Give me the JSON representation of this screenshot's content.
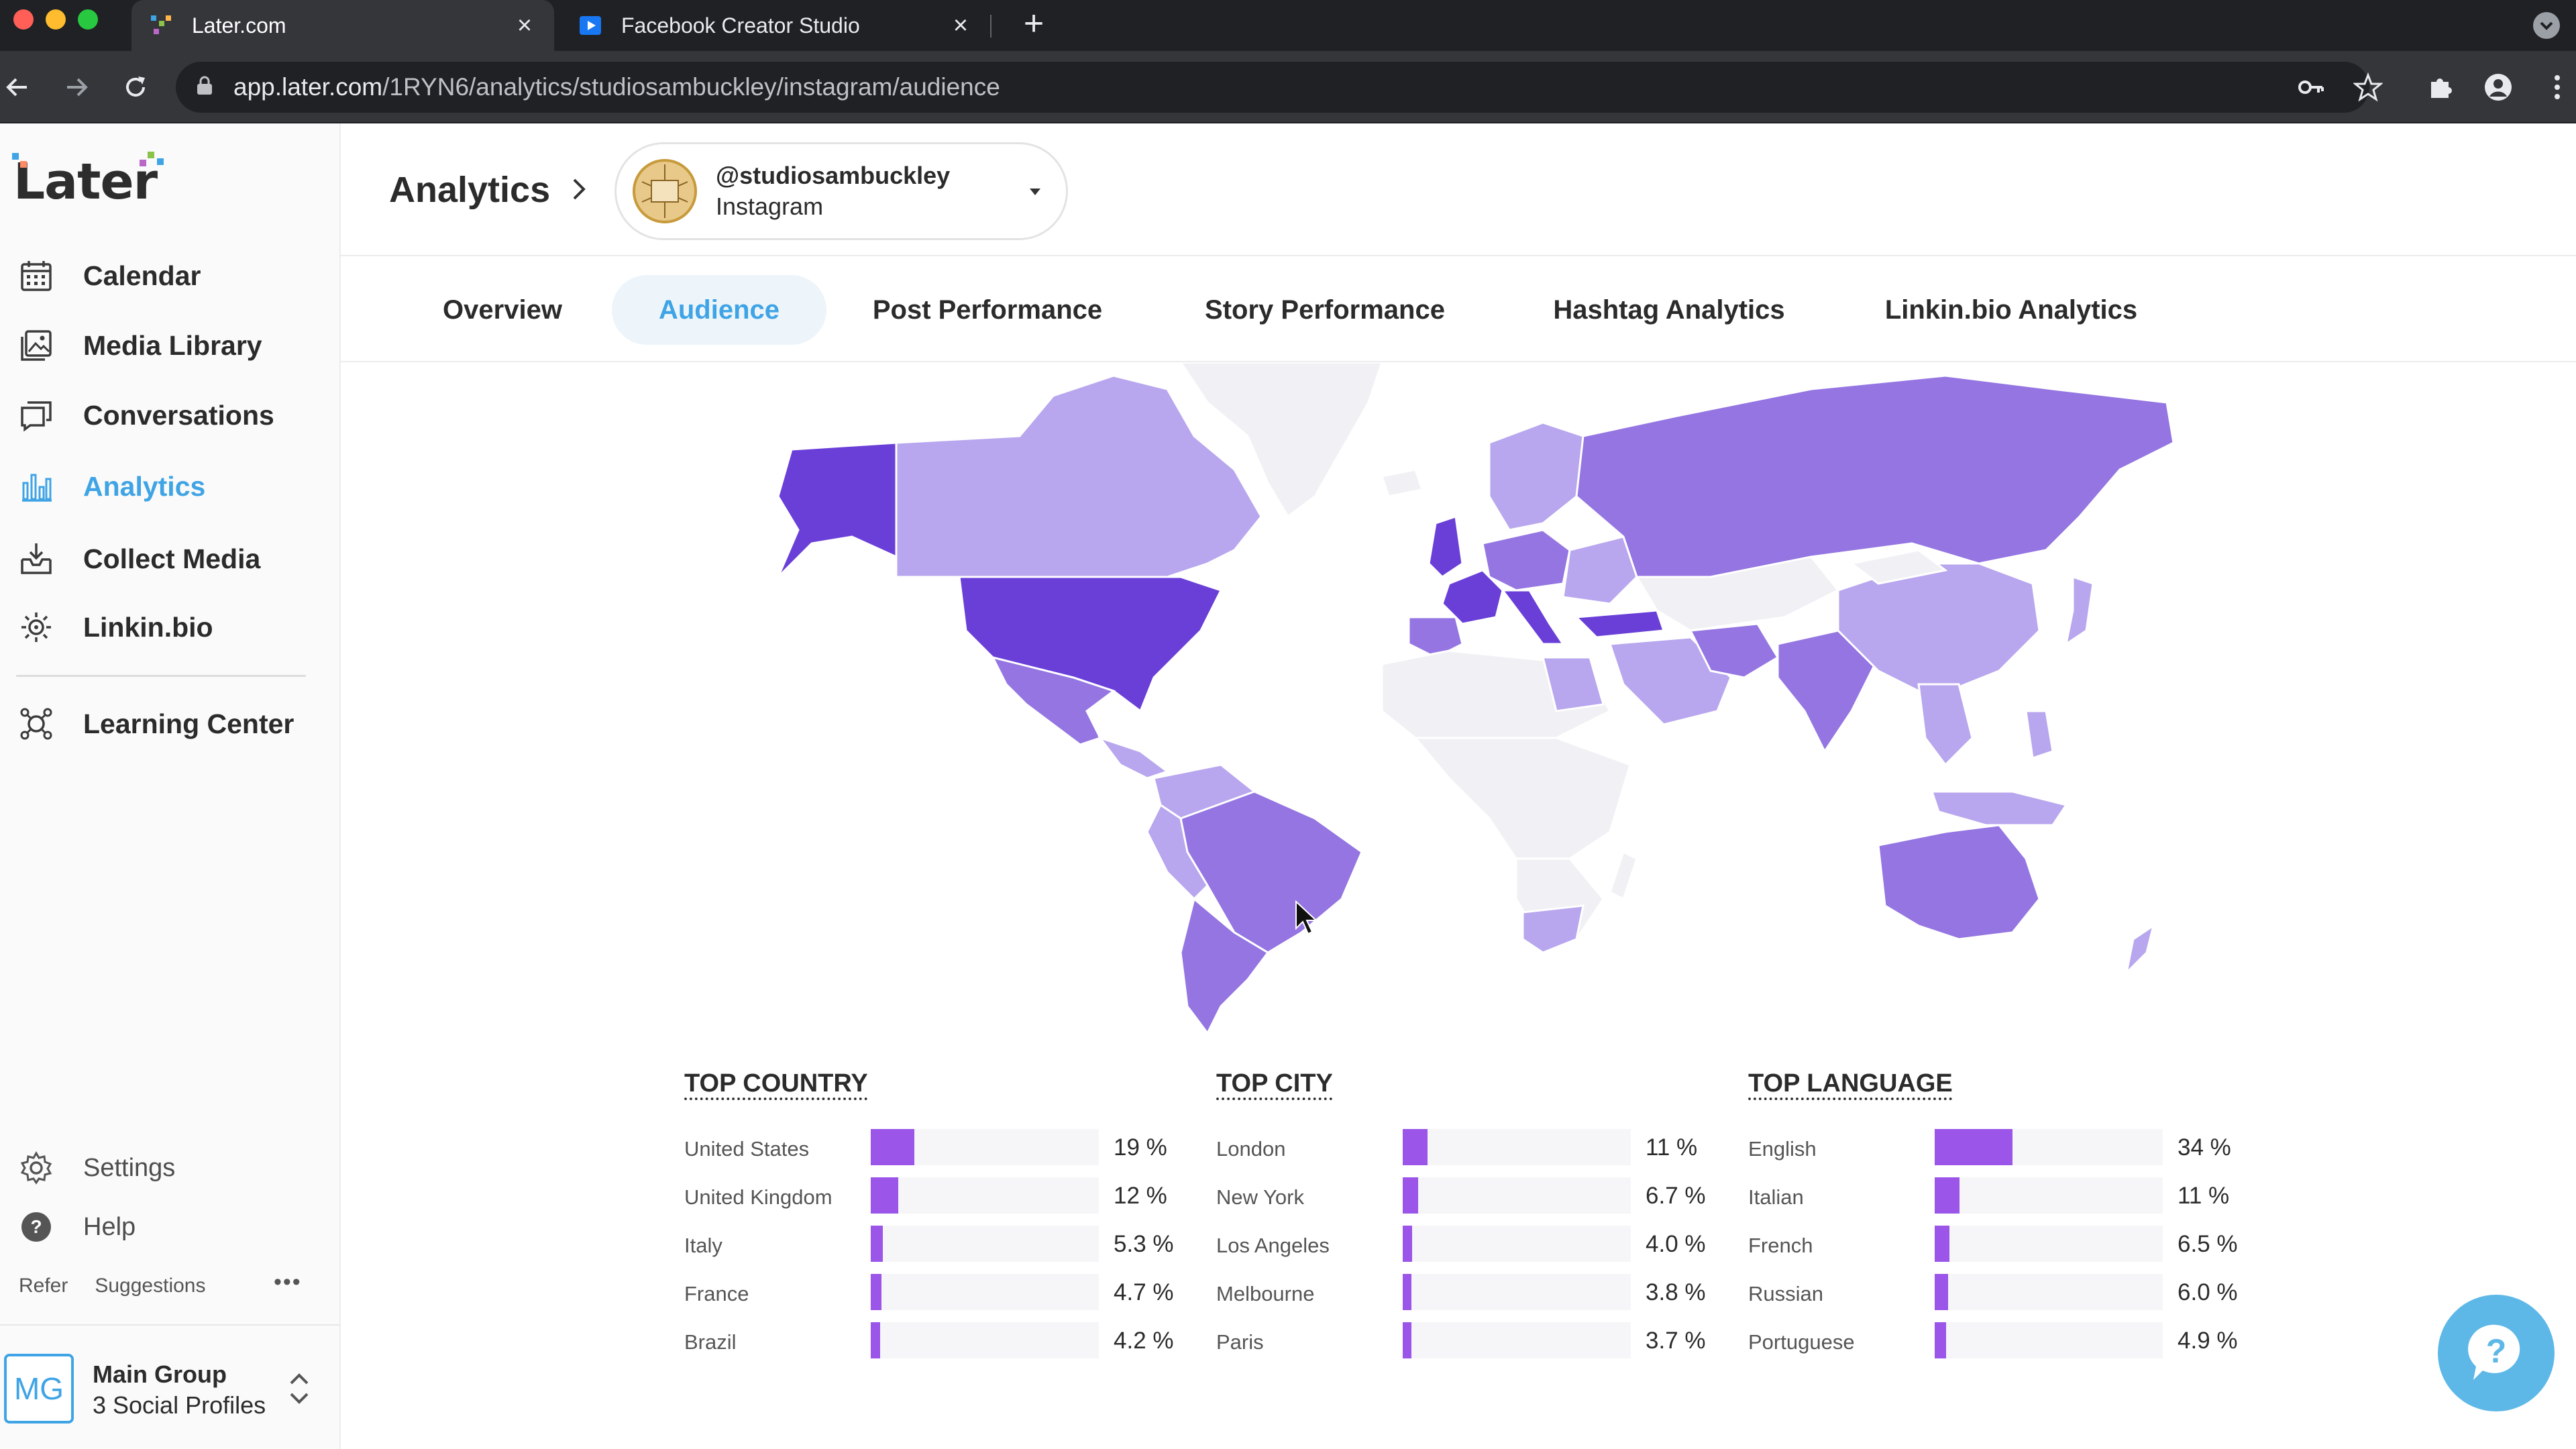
{
  "browser": {
    "tabs": [
      {
        "title": "Later.com",
        "active": true,
        "favicon": "later-favicon"
      },
      {
        "title": "Facebook Creator Studio",
        "active": false,
        "favicon": "creator-studio-favicon"
      }
    ],
    "url_host": "app.later.com",
    "url_path": "/1RYN6/analytics/studiosambuckley/instagram/audience",
    "traffic_colors": [
      "#ff5f57",
      "#febc2e",
      "#28c840"
    ]
  },
  "sidebar": {
    "logo": "Later",
    "items": [
      {
        "label": "Calendar",
        "icon": "calendar-icon"
      },
      {
        "label": "Media Library",
        "icon": "image-icon"
      },
      {
        "label": "Conversations",
        "icon": "chat-icon"
      },
      {
        "label": "Analytics",
        "icon": "bar-chart-icon",
        "active": true
      },
      {
        "label": "Collect Media",
        "icon": "download-tray-icon"
      },
      {
        "label": "Linkin.bio",
        "icon": "link-gear-icon"
      },
      {
        "label": "Learning Center",
        "icon": "learning-icon"
      },
      {
        "label": "Settings",
        "icon": "gear-icon"
      },
      {
        "label": "Help",
        "icon": "question-icon"
      }
    ],
    "footer": {
      "refer": "Refer",
      "suggestions": "Suggestions",
      "more": "•••"
    },
    "account": {
      "initials": "MG",
      "name": "Main Group",
      "profiles": "3 Social Profiles"
    }
  },
  "header": {
    "breadcrumb": "Analytics",
    "profile_handle": "@studiosambuckley",
    "profile_network": "Instagram"
  },
  "tabs": [
    {
      "label": "Overview"
    },
    {
      "label": "Audience",
      "active": true
    },
    {
      "label": "Post Performance"
    },
    {
      "label": "Story Performance"
    },
    {
      "label": "Hashtag Analytics"
    },
    {
      "label": "Linkin.bio Analytics"
    }
  ],
  "colors": {
    "accent": "#3fa4e5",
    "bar": "#9b55e8",
    "map_high": "#6a3fd8",
    "map_mid": "#9475e2",
    "map_low": "#b8a6ee",
    "map_none": "#f1f1f5"
  },
  "stats": {
    "country": {
      "title": "TOP COUNTRY",
      "rows": [
        {
          "name": "United States",
          "pct": "19 %",
          "value": 19
        },
        {
          "name": "United Kingdom",
          "pct": "12 %",
          "value": 12
        },
        {
          "name": "Italy",
          "pct": "5.3 %",
          "value": 5.3
        },
        {
          "name": "France",
          "pct": "4.7 %",
          "value": 4.7
        },
        {
          "name": "Brazil",
          "pct": "4.2 %",
          "value": 4.2
        }
      ]
    },
    "city": {
      "title": "TOP CITY",
      "rows": [
        {
          "name": "London",
          "pct": "11 %",
          "value": 11
        },
        {
          "name": "New York",
          "pct": "6.7 %",
          "value": 6.7
        },
        {
          "name": "Los Angeles",
          "pct": "4.0 %",
          "value": 4.0
        },
        {
          "name": "Melbourne",
          "pct": "3.8 %",
          "value": 3.8
        },
        {
          "name": "Paris",
          "pct": "3.7 %",
          "value": 3.7
        }
      ]
    },
    "language": {
      "title": "TOP LANGUAGE",
      "rows": [
        {
          "name": "English",
          "pct": "34 %",
          "value": 34
        },
        {
          "name": "Italian",
          "pct": "11 %",
          "value": 11
        },
        {
          "name": "French",
          "pct": "6.5 %",
          "value": 6.5
        },
        {
          "name": "Russian",
          "pct": "6.0 %",
          "value": 6.0
        },
        {
          "name": "Portuguese",
          "pct": "4.9 %",
          "value": 4.9
        }
      ]
    }
  }
}
